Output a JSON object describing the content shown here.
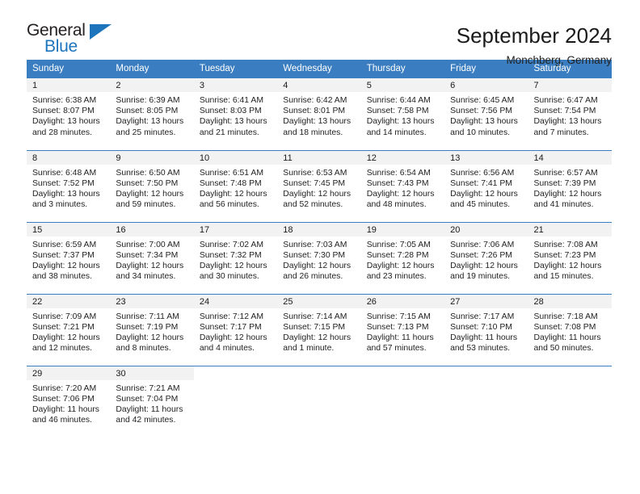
{
  "brand": {
    "name_part1": "General",
    "name_part2": "Blue"
  },
  "header": {
    "title": "September 2024",
    "subtitle": "Monchberg, Germany"
  },
  "colors": {
    "header_blue": "#3a7dc0",
    "brand_blue": "#1b74bc",
    "day_band_gray": "#f2f2f2",
    "text": "#222222"
  },
  "weekday_headers": [
    "Sunday",
    "Monday",
    "Tuesday",
    "Wednesday",
    "Thursday",
    "Friday",
    "Saturday"
  ],
  "labels": {
    "sunrise_prefix": "Sunrise:",
    "sunset_prefix": "Sunset:",
    "daylight_prefix": "Daylight:"
  },
  "weeks": [
    [
      {
        "day": "1",
        "sunrise": "Sunrise: 6:38 AM",
        "sunset": "Sunset: 8:07 PM",
        "daylight_line1": "Daylight: 13 hours",
        "daylight_line2": "and 28 minutes."
      },
      {
        "day": "2",
        "sunrise": "Sunrise: 6:39 AM",
        "sunset": "Sunset: 8:05 PM",
        "daylight_line1": "Daylight: 13 hours",
        "daylight_line2": "and 25 minutes."
      },
      {
        "day": "3",
        "sunrise": "Sunrise: 6:41 AM",
        "sunset": "Sunset: 8:03 PM",
        "daylight_line1": "Daylight: 13 hours",
        "daylight_line2": "and 21 minutes."
      },
      {
        "day": "4",
        "sunrise": "Sunrise: 6:42 AM",
        "sunset": "Sunset: 8:01 PM",
        "daylight_line1": "Daylight: 13 hours",
        "daylight_line2": "and 18 minutes."
      },
      {
        "day": "5",
        "sunrise": "Sunrise: 6:44 AM",
        "sunset": "Sunset: 7:58 PM",
        "daylight_line1": "Daylight: 13 hours",
        "daylight_line2": "and 14 minutes."
      },
      {
        "day": "6",
        "sunrise": "Sunrise: 6:45 AM",
        "sunset": "Sunset: 7:56 PM",
        "daylight_line1": "Daylight: 13 hours",
        "daylight_line2": "and 10 minutes."
      },
      {
        "day": "7",
        "sunrise": "Sunrise: 6:47 AM",
        "sunset": "Sunset: 7:54 PM",
        "daylight_line1": "Daylight: 13 hours",
        "daylight_line2": "and 7 minutes."
      }
    ],
    [
      {
        "day": "8",
        "sunrise": "Sunrise: 6:48 AM",
        "sunset": "Sunset: 7:52 PM",
        "daylight_line1": "Daylight: 13 hours",
        "daylight_line2": "and 3 minutes."
      },
      {
        "day": "9",
        "sunrise": "Sunrise: 6:50 AM",
        "sunset": "Sunset: 7:50 PM",
        "daylight_line1": "Daylight: 12 hours",
        "daylight_line2": "and 59 minutes."
      },
      {
        "day": "10",
        "sunrise": "Sunrise: 6:51 AM",
        "sunset": "Sunset: 7:48 PM",
        "daylight_line1": "Daylight: 12 hours",
        "daylight_line2": "and 56 minutes."
      },
      {
        "day": "11",
        "sunrise": "Sunrise: 6:53 AM",
        "sunset": "Sunset: 7:45 PM",
        "daylight_line1": "Daylight: 12 hours",
        "daylight_line2": "and 52 minutes."
      },
      {
        "day": "12",
        "sunrise": "Sunrise: 6:54 AM",
        "sunset": "Sunset: 7:43 PM",
        "daylight_line1": "Daylight: 12 hours",
        "daylight_line2": "and 48 minutes."
      },
      {
        "day": "13",
        "sunrise": "Sunrise: 6:56 AM",
        "sunset": "Sunset: 7:41 PM",
        "daylight_line1": "Daylight: 12 hours",
        "daylight_line2": "and 45 minutes."
      },
      {
        "day": "14",
        "sunrise": "Sunrise: 6:57 AM",
        "sunset": "Sunset: 7:39 PM",
        "daylight_line1": "Daylight: 12 hours",
        "daylight_line2": "and 41 minutes."
      }
    ],
    [
      {
        "day": "15",
        "sunrise": "Sunrise: 6:59 AM",
        "sunset": "Sunset: 7:37 PM",
        "daylight_line1": "Daylight: 12 hours",
        "daylight_line2": "and 38 minutes."
      },
      {
        "day": "16",
        "sunrise": "Sunrise: 7:00 AM",
        "sunset": "Sunset: 7:34 PM",
        "daylight_line1": "Daylight: 12 hours",
        "daylight_line2": "and 34 minutes."
      },
      {
        "day": "17",
        "sunrise": "Sunrise: 7:02 AM",
        "sunset": "Sunset: 7:32 PM",
        "daylight_line1": "Daylight: 12 hours",
        "daylight_line2": "and 30 minutes."
      },
      {
        "day": "18",
        "sunrise": "Sunrise: 7:03 AM",
        "sunset": "Sunset: 7:30 PM",
        "daylight_line1": "Daylight: 12 hours",
        "daylight_line2": "and 26 minutes."
      },
      {
        "day": "19",
        "sunrise": "Sunrise: 7:05 AM",
        "sunset": "Sunset: 7:28 PM",
        "daylight_line1": "Daylight: 12 hours",
        "daylight_line2": "and 23 minutes."
      },
      {
        "day": "20",
        "sunrise": "Sunrise: 7:06 AM",
        "sunset": "Sunset: 7:26 PM",
        "daylight_line1": "Daylight: 12 hours",
        "daylight_line2": "and 19 minutes."
      },
      {
        "day": "21",
        "sunrise": "Sunrise: 7:08 AM",
        "sunset": "Sunset: 7:23 PM",
        "daylight_line1": "Daylight: 12 hours",
        "daylight_line2": "and 15 minutes."
      }
    ],
    [
      {
        "day": "22",
        "sunrise": "Sunrise: 7:09 AM",
        "sunset": "Sunset: 7:21 PM",
        "daylight_line1": "Daylight: 12 hours",
        "daylight_line2": "and 12 minutes."
      },
      {
        "day": "23",
        "sunrise": "Sunrise: 7:11 AM",
        "sunset": "Sunset: 7:19 PM",
        "daylight_line1": "Daylight: 12 hours",
        "daylight_line2": "and 8 minutes."
      },
      {
        "day": "24",
        "sunrise": "Sunrise: 7:12 AM",
        "sunset": "Sunset: 7:17 PM",
        "daylight_line1": "Daylight: 12 hours",
        "daylight_line2": "and 4 minutes."
      },
      {
        "day": "25",
        "sunrise": "Sunrise: 7:14 AM",
        "sunset": "Sunset: 7:15 PM",
        "daylight_line1": "Daylight: 12 hours",
        "daylight_line2": "and 1 minute."
      },
      {
        "day": "26",
        "sunrise": "Sunrise: 7:15 AM",
        "sunset": "Sunset: 7:13 PM",
        "daylight_line1": "Daylight: 11 hours",
        "daylight_line2": "and 57 minutes."
      },
      {
        "day": "27",
        "sunrise": "Sunrise: 7:17 AM",
        "sunset": "Sunset: 7:10 PM",
        "daylight_line1": "Daylight: 11 hours",
        "daylight_line2": "and 53 minutes."
      },
      {
        "day": "28",
        "sunrise": "Sunrise: 7:18 AM",
        "sunset": "Sunset: 7:08 PM",
        "daylight_line1": "Daylight: 11 hours",
        "daylight_line2": "and 50 minutes."
      }
    ],
    [
      {
        "day": "29",
        "sunrise": "Sunrise: 7:20 AM",
        "sunset": "Sunset: 7:06 PM",
        "daylight_line1": "Daylight: 11 hours",
        "daylight_line2": "and 46 minutes."
      },
      {
        "day": "30",
        "sunrise": "Sunrise: 7:21 AM",
        "sunset": "Sunset: 7:04 PM",
        "daylight_line1": "Daylight: 11 hours",
        "daylight_line2": "and 42 minutes."
      },
      {
        "day": "",
        "sunrise": "",
        "sunset": "",
        "daylight_line1": "",
        "daylight_line2": ""
      },
      {
        "day": "",
        "sunrise": "",
        "sunset": "",
        "daylight_line1": "",
        "daylight_line2": ""
      },
      {
        "day": "",
        "sunrise": "",
        "sunset": "",
        "daylight_line1": "",
        "daylight_line2": ""
      },
      {
        "day": "",
        "sunrise": "",
        "sunset": "",
        "daylight_line1": "",
        "daylight_line2": ""
      },
      {
        "day": "",
        "sunrise": "",
        "sunset": "",
        "daylight_line1": "",
        "daylight_line2": ""
      }
    ]
  ]
}
